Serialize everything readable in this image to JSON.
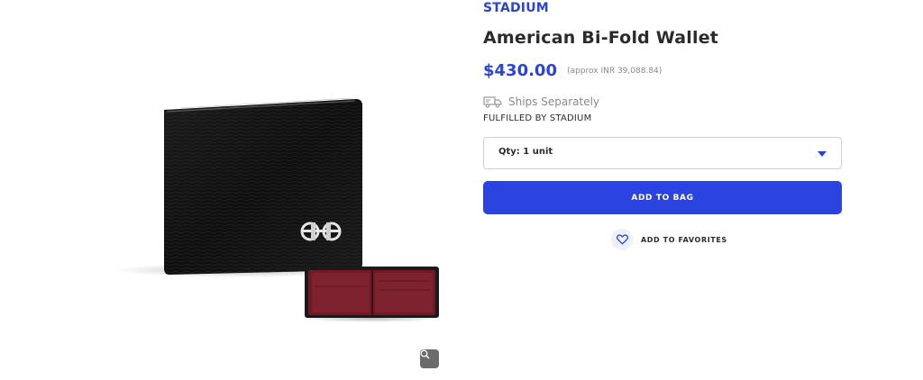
{
  "product": {
    "brand": "STADIUM",
    "title": "American Bi-Fold Wallet",
    "price": "$430.00",
    "approx_price": "(approx INR 39,088.84)",
    "shipping": {
      "icon": "truck-icon",
      "text": "Ships Separately"
    },
    "fulfilled_by": "FULFILLED BY STADIUM"
  },
  "purchase": {
    "quantity_label": "Qty: 1 unit",
    "add_to_bag_label": "ADD TO BAG",
    "favorites_label": "ADD TO FAVORITES",
    "favorites_icon": "heart-icon"
  },
  "gallery": {
    "zoom_icon": "magnifier-icon"
  },
  "colors": {
    "accent": "#2b44d6",
    "button": "#2b44e0",
    "wallet_leather": "#111111",
    "wallet_interior": "#7a1c27"
  }
}
